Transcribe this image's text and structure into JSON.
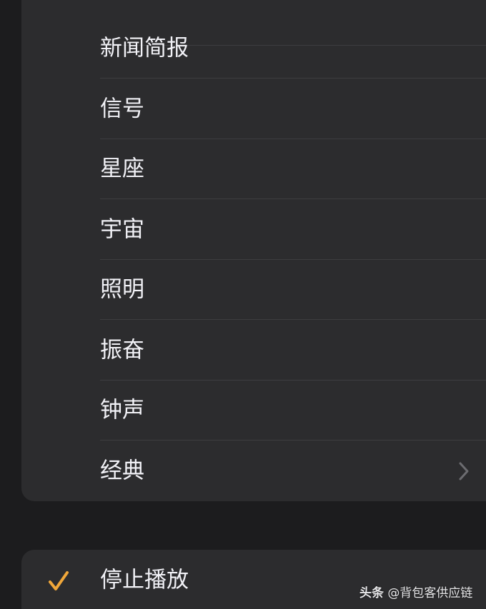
{
  "colors": {
    "background": "#1c1c1e",
    "group_background": "#2c2c2e",
    "separator": "#3d3d40",
    "text": "#f2f2f7",
    "checkmark": "#f0a73a",
    "chevron": "#6c6c70"
  },
  "menu": {
    "items": [
      {
        "label": "新闻简报"
      },
      {
        "label": "信号"
      },
      {
        "label": "星座"
      },
      {
        "label": "宇宙"
      },
      {
        "label": "照明"
      },
      {
        "label": "振奋"
      },
      {
        "label": "钟声"
      },
      {
        "label": "经典",
        "icon": "chevron-right-icon"
      }
    ]
  },
  "stop": {
    "label": "停止播放",
    "checked": true,
    "icon": "checkmark-icon"
  },
  "watermark": {
    "brand": "头条",
    "handle": "@背包客供应链"
  }
}
